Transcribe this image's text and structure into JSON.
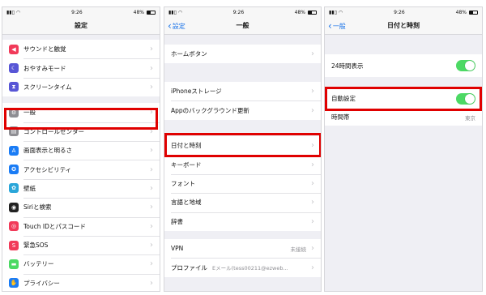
{
  "panels": [
    {
      "status": {
        "time": "9:26",
        "battery": "48%"
      },
      "title": "設定",
      "items": [
        {
          "label": "サウンドと触覚",
          "icon": "speaker-icon",
          "color": "#f13a59"
        },
        {
          "label": "おやすみモード",
          "icon": "moon-icon",
          "color": "#5856d6"
        },
        {
          "label": "スクリーンタイム",
          "icon": "hourglass-icon",
          "color": "#5856d6"
        },
        {
          "label": "一般",
          "icon": "gear-icon",
          "color": "#8e8e93"
        },
        {
          "label": "コントロールセンター",
          "icon": "switches-icon",
          "color": "#8e8e93"
        },
        {
          "label": "画面表示と明るさ",
          "icon": "display-aa-icon",
          "color": "#1a7cf5"
        },
        {
          "label": "アクセシビリティ",
          "icon": "accessibility-icon",
          "color": "#1a7cf5"
        },
        {
          "label": "壁紙",
          "icon": "wallpaper-icon",
          "color": "#2aa6d9"
        },
        {
          "label": "Siriと検索",
          "icon": "siri-icon",
          "color": "#222222"
        },
        {
          "label": "Touch IDとパスコード",
          "icon": "fingerprint-icon",
          "color": "#f13a59"
        },
        {
          "label": "緊急SOS",
          "icon": "sos-icon",
          "color": "#f13a59"
        },
        {
          "label": "バッテリー",
          "icon": "battery-icon",
          "color": "#4cd964"
        },
        {
          "label": "プライバシー",
          "icon": "hand-icon",
          "color": "#1a7cf5"
        }
      ]
    },
    {
      "status": {
        "time": "9:26",
        "battery": "48%"
      },
      "back": "設定",
      "title": "一般",
      "groups": [
        [
          {
            "label": "ホームボタン"
          }
        ],
        [
          {
            "label": "iPhoneストレージ"
          },
          {
            "label": "Appのバックグラウンド更新"
          }
        ],
        [
          {
            "label": "日付と時刻"
          },
          {
            "label": "キーボード"
          },
          {
            "label": "フォント"
          },
          {
            "label": "言語と地域"
          },
          {
            "label": "辞書"
          }
        ],
        [
          {
            "label": "VPN",
            "value": "未接続"
          },
          {
            "label": "プロファイル",
            "value": "Eメール(tess00211@ezweb..."
          }
        ]
      ]
    },
    {
      "status": {
        "time": "9:26",
        "battery": "48%"
      },
      "back": "一般",
      "title": "日付と時刻",
      "toggle_24": {
        "label": "24時間表示",
        "on": true
      },
      "auto": {
        "label": "自動設定",
        "on": true
      },
      "timezone": {
        "label": "時間帯",
        "value": "東京"
      }
    }
  ]
}
